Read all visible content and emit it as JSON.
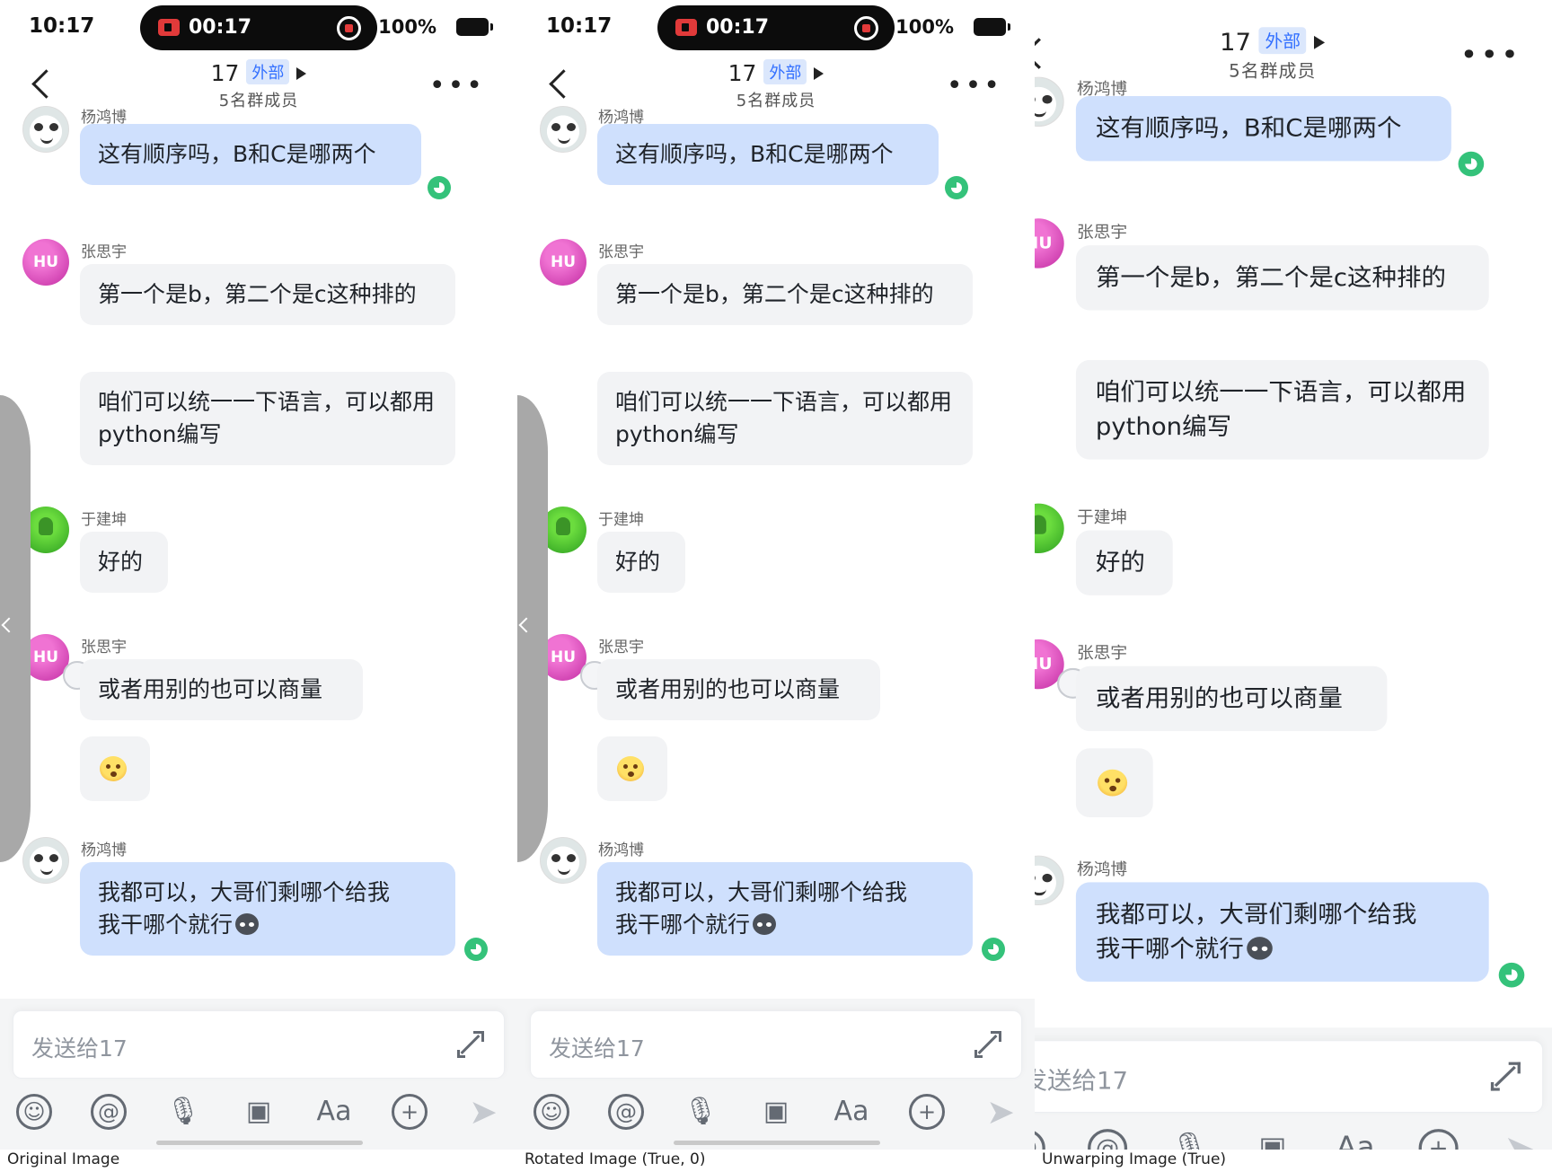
{
  "status": {
    "time": "10:17",
    "record_time": "00:17",
    "battery": "100%"
  },
  "chat": {
    "title_num": "17",
    "tag": "外部",
    "members": "5名群成员"
  },
  "messages": {
    "m1_name": "杨鸿博",
    "m1_text": "这有顺序吗，B和C是哪两个",
    "m2_name": "张思宇",
    "m2_text": "第一个是b，第二个是c这种排的",
    "m3_text": "咱们可以统一一下语言，可以都用python编写",
    "m4_name": "于建坤",
    "m4_text": "好的",
    "m5_name": "张思宇",
    "m5_text": "或者用别的也可以商量",
    "m6_name": "杨鸿博",
    "m6_text_1": "我都可以，大哥们剩哪个给我",
    "m6_text_2": "我干哪个就行",
    "avatar_hu": "HU"
  },
  "input": {
    "placeholder": "发送给17"
  },
  "toolbar": {
    "icons": [
      "smile-icon",
      "at-icon",
      "mic-icon",
      "image-icon",
      "font-icon",
      "plus-icon",
      "send-icon"
    ],
    "font_label": "Aa"
  },
  "captions": [
    "Original Image",
    "Rotated Image (True, 0)",
    "Unwarping Image (True)"
  ]
}
